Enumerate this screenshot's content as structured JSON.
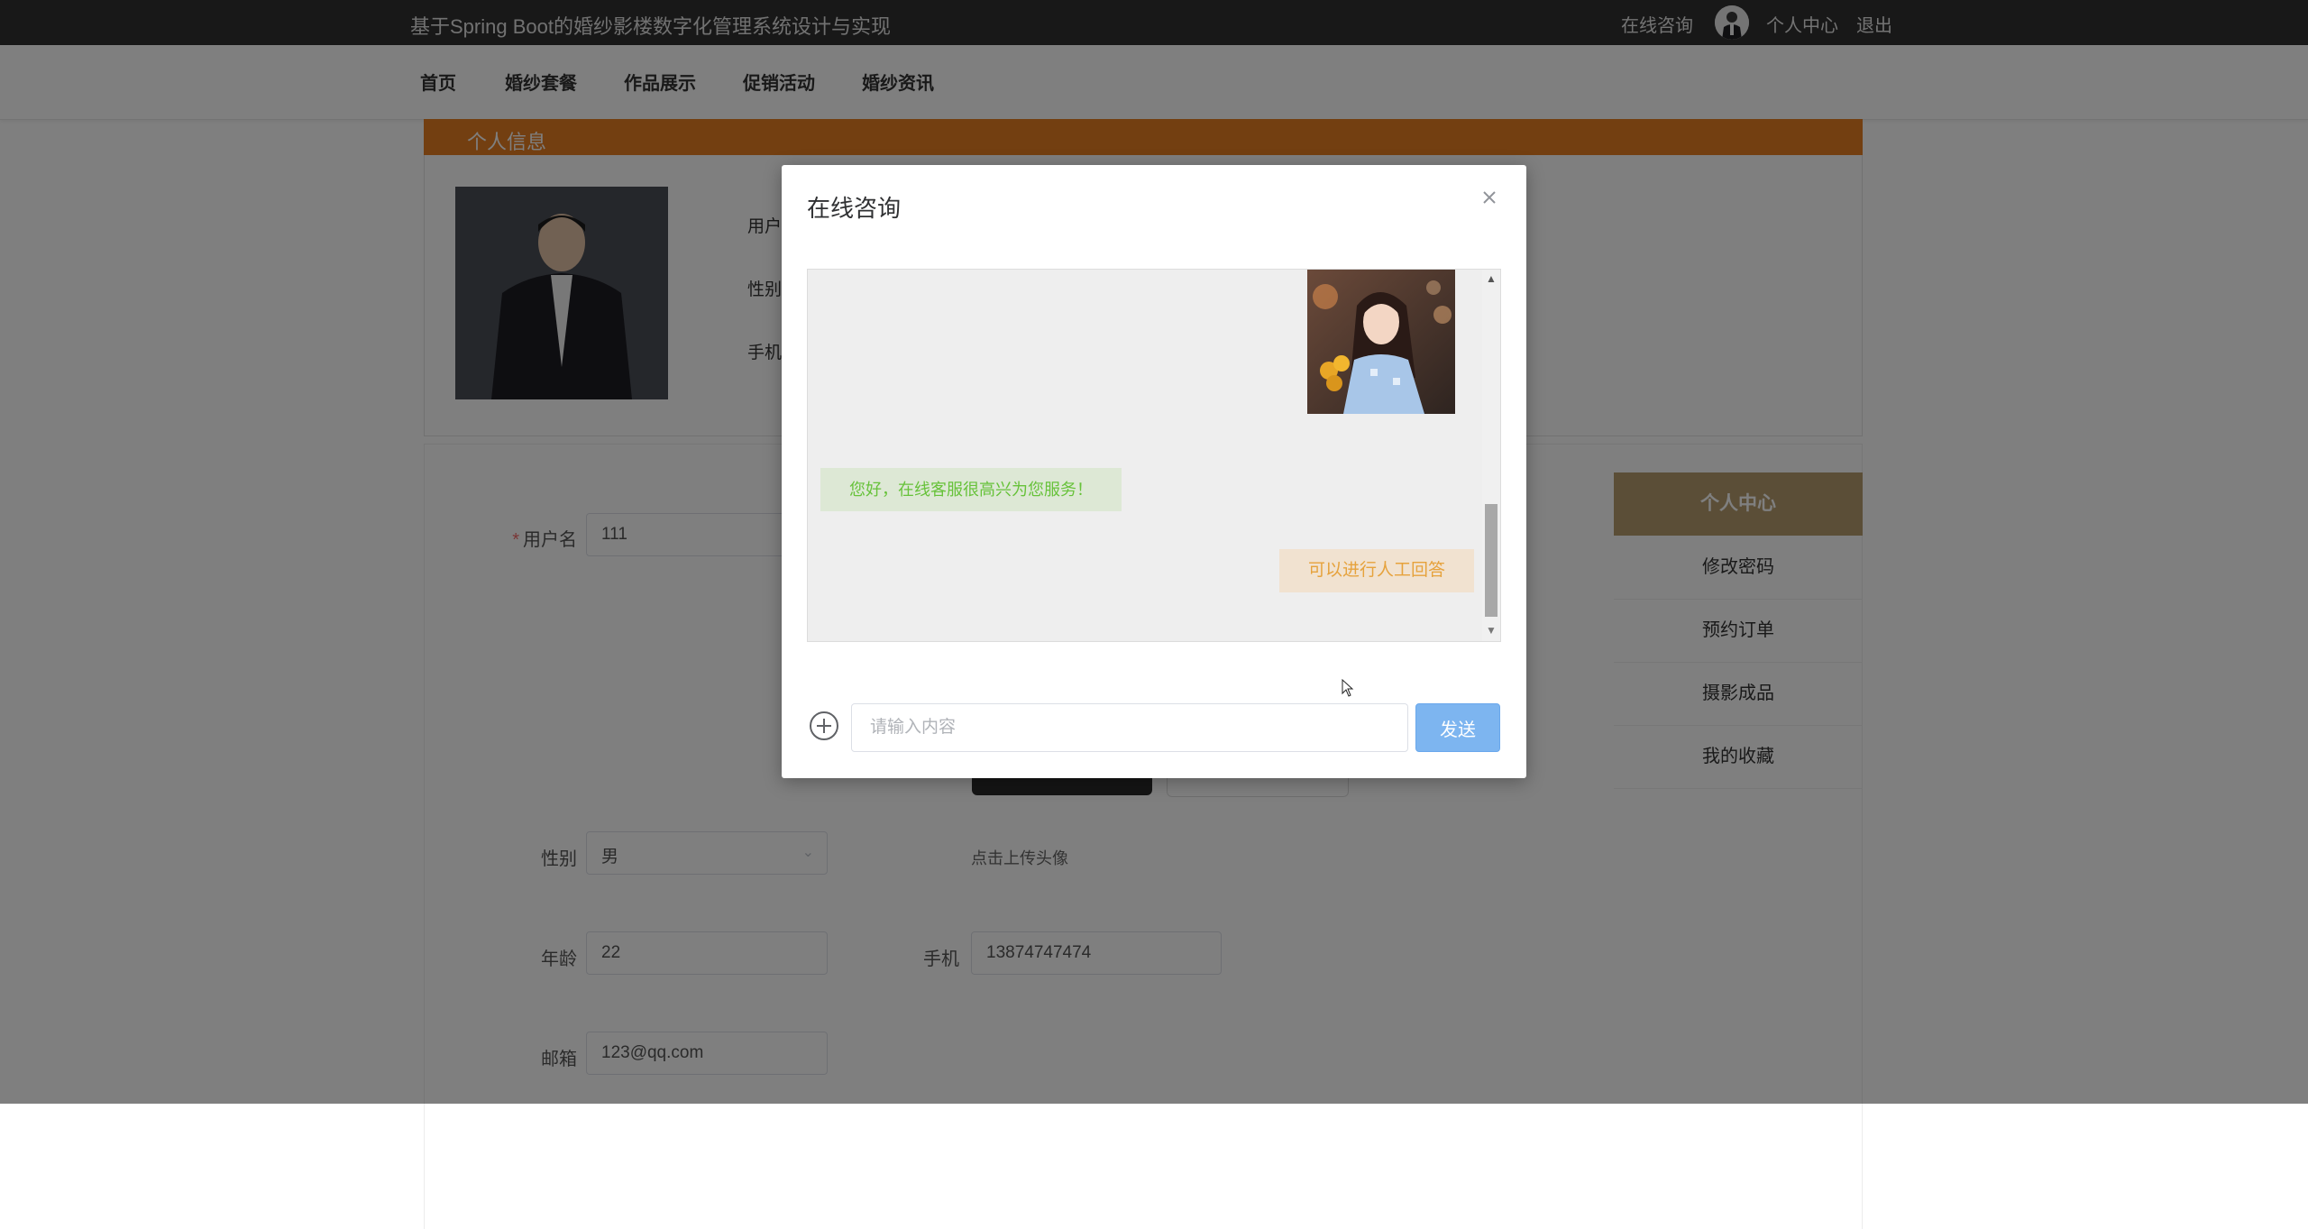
{
  "header": {
    "site_title": "基于Spring Boot的婚纱影楼数字化管理系统设计与实现",
    "online_consult": "在线咨询",
    "user_center": "个人中心",
    "logout": "退出"
  },
  "nav": {
    "items": [
      "首页",
      "婚纱套餐",
      "作品展示",
      "促销活动",
      "婚纱资讯"
    ]
  },
  "profile_card": {
    "header": "个人信息",
    "labels": [
      "用户",
      "性别",
      "手机"
    ]
  },
  "form": {
    "username_label": "用户名",
    "username_value": "111",
    "gender_label": "性别",
    "gender_value": "男",
    "upload_hint": "点击上传头像",
    "age_label": "年龄",
    "age_value": "22",
    "phone_label": "手机",
    "phone_value": "13874747474",
    "email_label": "邮箱",
    "email_value": "123@qq.com"
  },
  "side_menu": {
    "header": "个人中心",
    "items": [
      "修改密码",
      "预约订单",
      "摄影成品",
      "我的收藏"
    ]
  },
  "dialog": {
    "title": "在线咨询",
    "messages": [
      {
        "from": "service",
        "text": "您好，在线客服很高兴为您服务！"
      },
      {
        "from": "user",
        "text": "可以进行人工回答"
      }
    ],
    "input_placeholder": "请输入内容",
    "send_label": "发送"
  },
  "colors": {
    "topbar": "#303030",
    "info_header": "#e67e22",
    "side_header": "#b69d6e",
    "send_button": "#7db5f0",
    "service_text": "#67c23a",
    "user_text": "#e6a23c"
  }
}
